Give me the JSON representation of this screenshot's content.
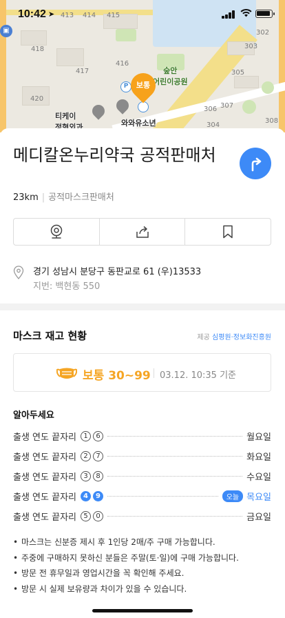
{
  "status_bar": {
    "time": "10:42",
    "location_icon": "location-arrow-icon",
    "signal_icon": "signal-icon",
    "wifi_icon": "wifi-icon",
    "battery_icon": "battery-icon"
  },
  "map": {
    "block_numbers": [
      "413",
      "414",
      "415",
      "418",
      "417",
      "416",
      "420",
      "302",
      "303",
      "305",
      "307",
      "308",
      "306",
      "304"
    ],
    "labels": {
      "clinic": "티케이\n정형외과",
      "park": "숲안\n어린이공원",
      "youth": "와와유소년\n스포츠"
    },
    "selected_pin_label": "보통",
    "parking_marker": "P"
  },
  "place": {
    "name": "메디칼온누리약국 공적판매처",
    "distance": "23km",
    "category": "공적마스크판매처",
    "route_icon": "directions-icon"
  },
  "actions": [
    {
      "icon": "cctv-icon"
    },
    {
      "icon": "share-icon"
    },
    {
      "icon": "bookmark-icon"
    }
  ],
  "address": {
    "road": "경기 성남시 분당구 동판교로 61 (우)13533",
    "lot": "지번: 백현동 550"
  },
  "mask_stock": {
    "heading": "마스크 재고 현황",
    "provider_prefix": "제공",
    "provider": "심평원·정보화진흥원",
    "level": "보통 30~99",
    "timestamp": "03.12. 10:35 기준",
    "level_color": "#f5a524"
  },
  "notice": {
    "title": "알아두세요",
    "row_label": "출생 연도 끝자리",
    "today_badge": "오늘",
    "rows": [
      {
        "digits": [
          "1",
          "6"
        ],
        "day": "월요일",
        "today": false
      },
      {
        "digits": [
          "2",
          "7"
        ],
        "day": "화요일",
        "today": false
      },
      {
        "digits": [
          "3",
          "8"
        ],
        "day": "수요일",
        "today": false
      },
      {
        "digits": [
          "4",
          "9"
        ],
        "day": "목요일",
        "today": true
      },
      {
        "digits": [
          "5",
          "0"
        ],
        "day": "금요일",
        "today": false
      }
    ],
    "bullets": [
      "마스크는 신분증 제시 후 1인당 2매/주 구매 가능합니다.",
      "주중에 구매하지 못하신 분들은 주말(토·일)에 구매 가능합니다.",
      "방문 전 휴무일과 영업시간을 꼭 확인해 주세요.",
      "방문 시 실제 보유량과 차이가 있을 수 있습니다."
    ]
  },
  "colors": {
    "accent": "#3d8af7",
    "warning": "#f5a524"
  }
}
